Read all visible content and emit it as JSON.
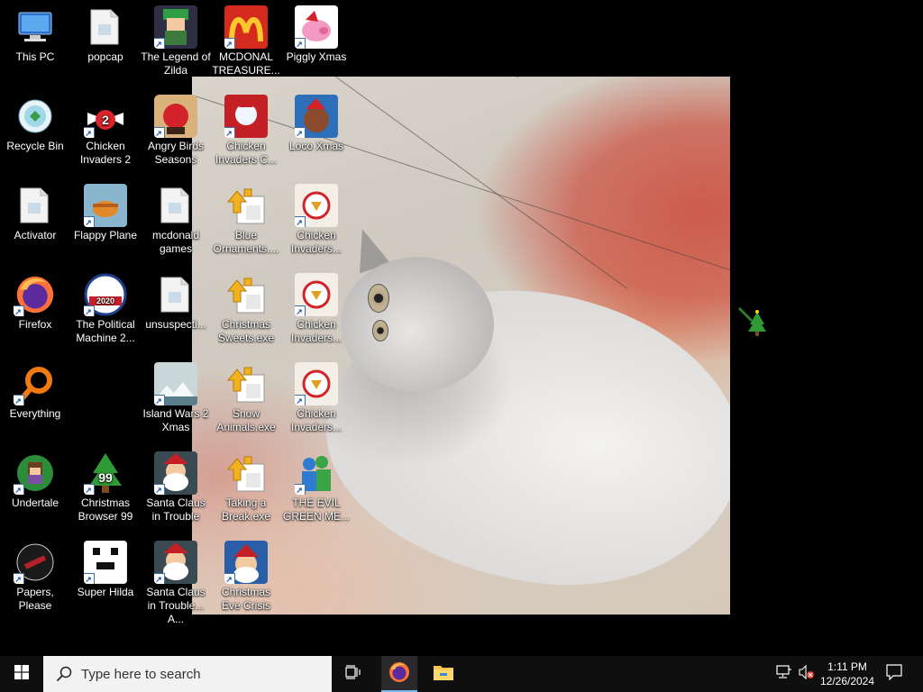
{
  "desktop": {
    "icons": [
      {
        "label": "This PC",
        "icon": "this-pc-icon",
        "shortcut": false
      },
      {
        "label": "popcap",
        "icon": "folder-icon",
        "shortcut": false
      },
      {
        "label": "The Legend of Zilda",
        "icon": "legend-of-zilda-icon",
        "shortcut": true
      },
      {
        "label": "MCDONAL TREASURE...",
        "icon": "mcdonalds-icon",
        "shortcut": true
      },
      {
        "label": "Piggly Xmas",
        "icon": "piggly-xmas-icon",
        "shortcut": true
      },
      {
        "label": "Recycle Bin",
        "icon": "recycle-bin-icon",
        "shortcut": false
      },
      {
        "label": "Chicken Invaders 2",
        "icon": "chicken-invaders-2-icon",
        "shortcut": true
      },
      {
        "label": "Angry Birds Seasons",
        "icon": "angry-birds-seasons-icon",
        "shortcut": true
      },
      {
        "label": "Chicken Invaders C...",
        "icon": "chicken-invaders-c-icon",
        "shortcut": true
      },
      {
        "label": "Loco Xmas",
        "icon": "loco-xmas-icon",
        "shortcut": true
      },
      {
        "label": "Activator",
        "icon": "folder-icon",
        "shortcut": false
      },
      {
        "label": "Flappy Plane",
        "icon": "flappy-plane-icon",
        "shortcut": true
      },
      {
        "label": "mcdonald games",
        "icon": "folder-icon",
        "shortcut": false
      },
      {
        "label": "Blue Ornaments....",
        "icon": "puzzle-exe-icon",
        "shortcut": false
      },
      {
        "label": "Chicken Invaders...",
        "icon": "chicken-invaders-icon",
        "shortcut": true
      },
      {
        "label": "Firefox",
        "icon": "firefox-icon",
        "shortcut": true
      },
      {
        "label": "The Political Machine 2...",
        "icon": "political-machine-icon",
        "shortcut": true
      },
      {
        "label": "unsuspecti...",
        "icon": "folder-icon",
        "shortcut": false
      },
      {
        "label": "Christmas Sweets.exe",
        "icon": "puzzle-exe-icon",
        "shortcut": false
      },
      {
        "label": "Chicken Invaders...",
        "icon": "chicken-invaders-icon",
        "shortcut": true
      },
      {
        "label": "Everything",
        "icon": "everything-search-icon",
        "shortcut": true
      },
      {
        "label": "Island Wars 2 Xmas",
        "icon": "island-wars-icon",
        "shortcut": true
      },
      {
        "label": "Snow Animals.exe",
        "icon": "puzzle-exe-icon",
        "shortcut": false
      },
      {
        "label": "Chicken Invaders...",
        "icon": "chicken-invaders-icon",
        "shortcut": true
      },
      {
        "label": "Undertale",
        "icon": "undertale-icon",
        "shortcut": true
      },
      {
        "label": "Christmas Browser 99",
        "icon": "christmas-browser-icon",
        "shortcut": true
      },
      {
        "label": "Santa Claus in Trouble",
        "icon": "santa-claus-icon",
        "shortcut": true
      },
      {
        "label": "Taking a Break.exe",
        "icon": "puzzle-exe-icon",
        "shortcut": false
      },
      {
        "label": "THE EVIL GREEN ME...",
        "icon": "evil-green-icon",
        "shortcut": true
      },
      {
        "label": "Papers, Please",
        "icon": "papers-please-icon",
        "shortcut": true
      },
      {
        "label": "Super Hilda",
        "icon": "super-hilda-icon",
        "shortcut": true
      },
      {
        "label": "Santa Claus in Trouble... A...",
        "icon": "santa-claus-icon",
        "shortcut": true
      },
      {
        "label": "Christmas Eve Crisis",
        "icon": "christmas-eve-crisis-icon",
        "shortcut": true
      }
    ]
  },
  "taskbar": {
    "search_placeholder": "Type here to search",
    "clock_time": "1:11 PM",
    "clock_date": "12/26/2024"
  },
  "colors": {
    "taskbar_bg": "#0f0f10",
    "search_bg": "#f2f2f2",
    "accent": "#76b9ed"
  }
}
